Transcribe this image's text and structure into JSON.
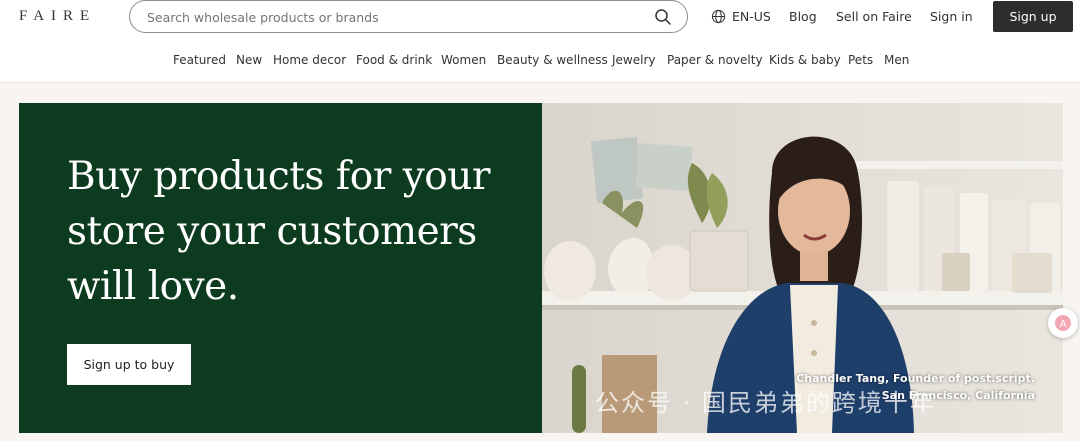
{
  "header": {
    "logo": "FAIRE",
    "search": {
      "placeholder": "Search wholesale products or brands",
      "value": ""
    },
    "language": "EN-US",
    "blog": "Blog",
    "sell": "Sell on Faire",
    "signin": "Sign in",
    "signup": "Sign up"
  },
  "categories": [
    "Featured",
    "New",
    "Home decor",
    "Food & drink",
    "Women",
    "Beauty & wellness",
    "Jewelry",
    "Paper & novelty",
    "Kids & baby",
    "Pets",
    "Men"
  ],
  "hero": {
    "headline_lines": [
      "Buy products for your",
      "store your customers",
      "will love."
    ],
    "cta": "Sign up to buy",
    "caption_line1": "Chandler Tang, Founder of post.script.",
    "caption_line2": "San Francisco, California",
    "watermark": "公众号 · 国民弟弟的跨境十年"
  },
  "colors": {
    "hero_green": "#0d3b1f",
    "signup_bg": "#2d2d2d",
    "hero_bg": "#f7f4f1"
  }
}
